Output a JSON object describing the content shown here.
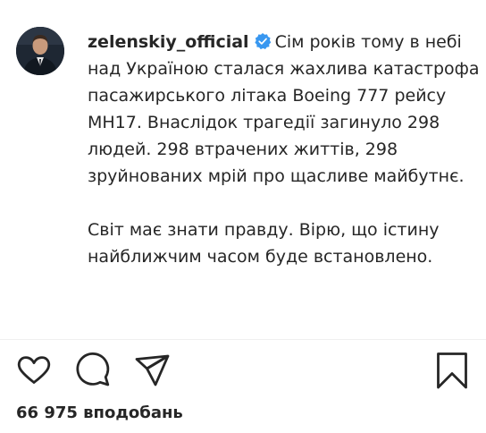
{
  "post": {
    "author": {
      "username": "zelenskiy_official",
      "verified": true,
      "avatar_icon": "profile-photo"
    },
    "caption_p1": "Сім років тому в небі над Україною сталася жахлива катастрофа пасажирського літака Boeing 777 рейсу MH17. Внаслідок трагедії загинуло 298 людей. 298 втрачених життів, 298 зруйнованих мрій про щасливе майбутнє.",
    "caption_p2": "Світ має знати правду. Вірю, що істину найближчим часом буде встановлено.",
    "actions": {
      "like_icon": "heart-icon",
      "comment_icon": "comment-icon",
      "share_icon": "paper-plane-icon",
      "save_icon": "bookmark-icon"
    },
    "likes": "66 975 вподобань"
  },
  "colors": {
    "text": "#262626",
    "verified_badge": "#3897f0",
    "divider": "#efefef"
  }
}
